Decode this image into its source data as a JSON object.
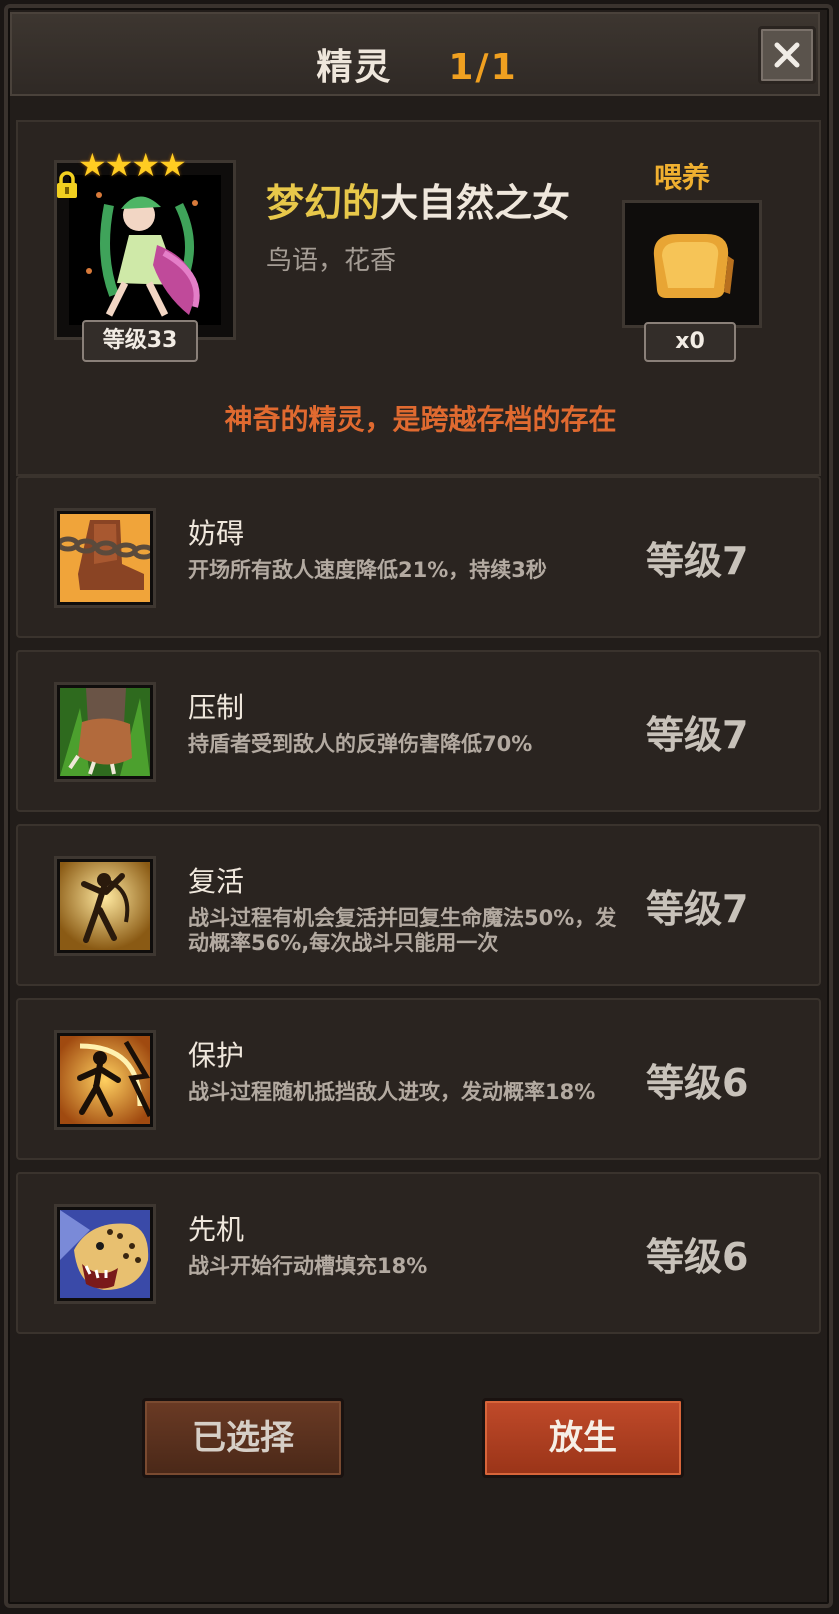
{
  "header": {
    "title": "精灵",
    "count": "1/1"
  },
  "spirit": {
    "stars": "★★★★",
    "level": "等级33",
    "name_prefix": "梦幻的",
    "name_main": "大自然之女",
    "subtitle": "鸟语，花香",
    "description": "神奇的精灵，是跨越存档的存在"
  },
  "feed": {
    "label": "喂养",
    "count": "x0"
  },
  "skills": [
    {
      "name": "妨碍",
      "desc": "开场所有敌人速度降低21%，持续3秒",
      "level": "等级7",
      "icon": "chained-boot-icon"
    },
    {
      "name": "压制",
      "desc": "持盾者受到敌人的反弹伤害降低70%",
      "level": "等级7",
      "icon": "claw-foot-icon"
    },
    {
      "name": "复活",
      "desc": "战斗过程有机会复活并回复生命魔法50%，发动概率56%,每次战斗只能用一次",
      "level": "等级7",
      "icon": "revive-figure-icon"
    },
    {
      "name": "保护",
      "desc": "战斗过程随机抵挡敌人进攻，发动概率18%",
      "level": "等级6",
      "icon": "protect-figure-icon"
    },
    {
      "name": "先机",
      "desc": "战斗开始行动槽填充18%",
      "level": "等级6",
      "icon": "leopard-icon"
    }
  ],
  "buttons": {
    "selected": "已选择",
    "release": "放生"
  },
  "colors": {
    "accent": "#f0a020",
    "gold_text": "#e8c84a",
    "desc_text": "#e06a30",
    "release_btn": "#c04a2a"
  }
}
